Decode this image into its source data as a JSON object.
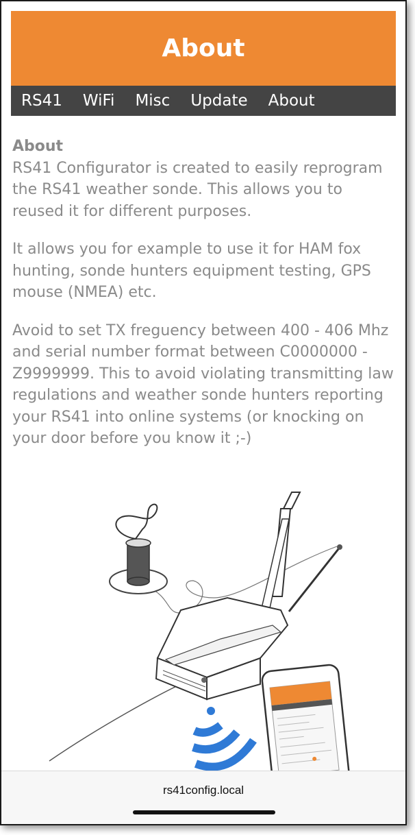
{
  "header": {
    "title": "About"
  },
  "nav": {
    "items": [
      "RS41",
      "WiFi",
      "Misc",
      "Update",
      "About"
    ]
  },
  "content": {
    "heading": "About",
    "paragraphs": [
      "RS41 Configurator is created to easily reprogram the RS41 weather sonde. This allows you to reused it for different purposes.",
      "It allows you for example to use it for HAM fox hunting, sonde hunters equipment testing, GPS mouse (NMEA) etc.",
      "Avoid to set TX freguency between 400 - 406 Mhz and serial number format between C0000000 - Z9999999. This to avoid violating transmitting law regulations and weather sonde hunters reporting your RS41 into online systems (or knocking on your door before you know it ;-)"
    ]
  },
  "browser": {
    "url": "rs41config.local"
  },
  "colors": {
    "header_bg": "#ee8933",
    "nav_bg": "#444444",
    "text": "#8a8a8a",
    "wifi": "#2f7ad6"
  },
  "illustration": {
    "icons": [
      "sonde-device-icon",
      "antenna-icon",
      "spool-icon",
      "phone-icon",
      "wifi-signal-icon"
    ]
  }
}
